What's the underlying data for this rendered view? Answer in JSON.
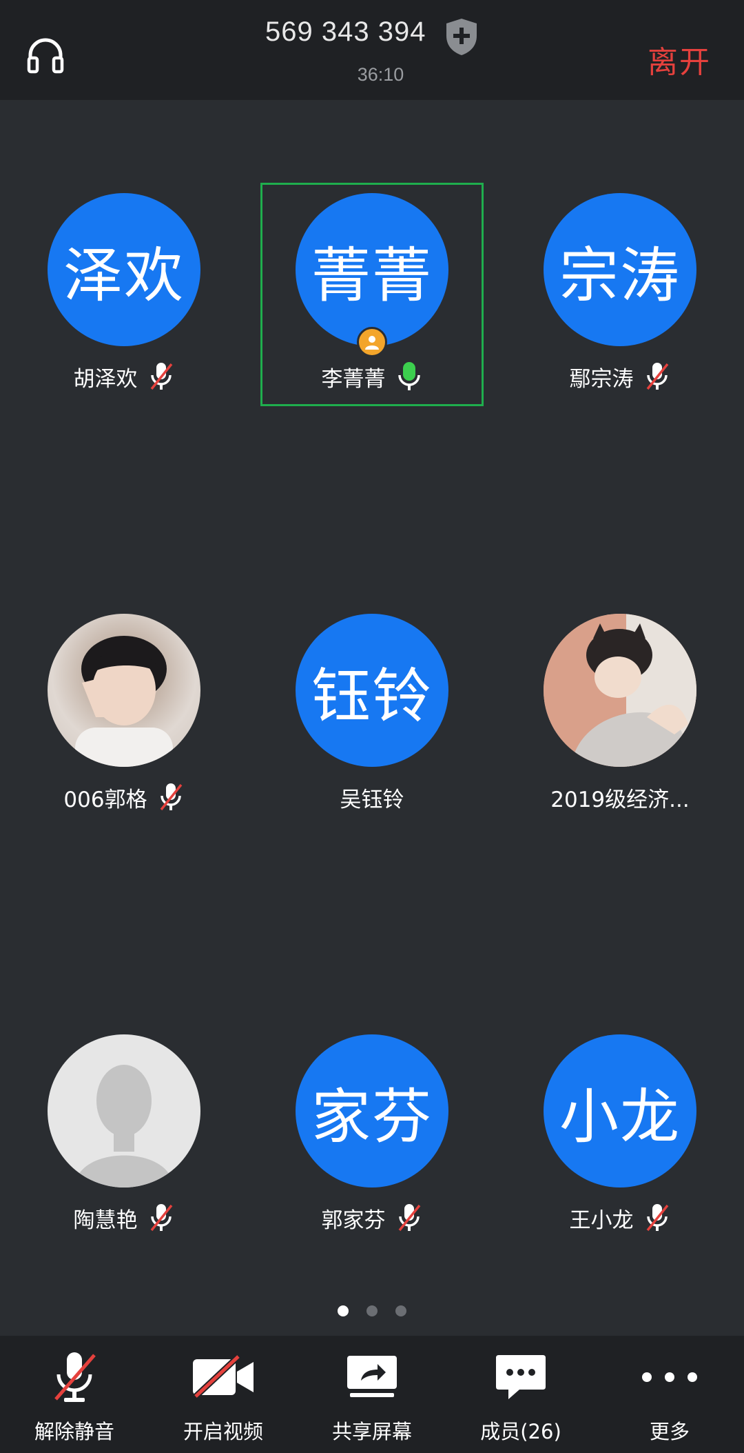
{
  "header": {
    "meeting_id": "569 343 394",
    "timer": "36:10",
    "leave_label": "离开"
  },
  "participants": [
    {
      "avatar_text": "泽欢",
      "name": "胡泽欢",
      "mic": "muted"
    },
    {
      "avatar_text": "菁菁",
      "name": "李菁菁",
      "mic": "active",
      "host": true,
      "speaking": true
    },
    {
      "avatar_text": "宗涛",
      "name": "鄢宗涛",
      "mic": "muted"
    },
    {
      "avatar_text": "",
      "name": "006郭格",
      "mic": "muted",
      "avatar": "photo"
    },
    {
      "avatar_text": "钰铃",
      "name": "吴钰铃",
      "mic": "none"
    },
    {
      "avatar_text": "",
      "name": "2019级经济...",
      "mic": "none",
      "avatar": "photo"
    },
    {
      "avatar_text": "",
      "name": "陶慧艳",
      "mic": "muted",
      "avatar": "default"
    },
    {
      "avatar_text": "家芬",
      "name": "郭家芬",
      "mic": "muted"
    },
    {
      "avatar_text": "小龙",
      "name": "王小龙",
      "mic": "muted"
    }
  ],
  "pager": {
    "pages": 3,
    "current": 1
  },
  "toolbar": {
    "unmute_label": "解除静音",
    "video_label": "开启视频",
    "share_label": "共享屏幕",
    "members_label": "成员(26)",
    "more_label": "更多"
  },
  "colors": {
    "background": "#2a2d31",
    "bar": "#1f2124",
    "avatar_blue": "#1778f2",
    "leave_red": "#e5413d",
    "speaking_green": "#1fae4d",
    "mic_active": "#3ccf4e",
    "muted_slash": "#e5413d",
    "host_badge": "#f3a52b"
  }
}
